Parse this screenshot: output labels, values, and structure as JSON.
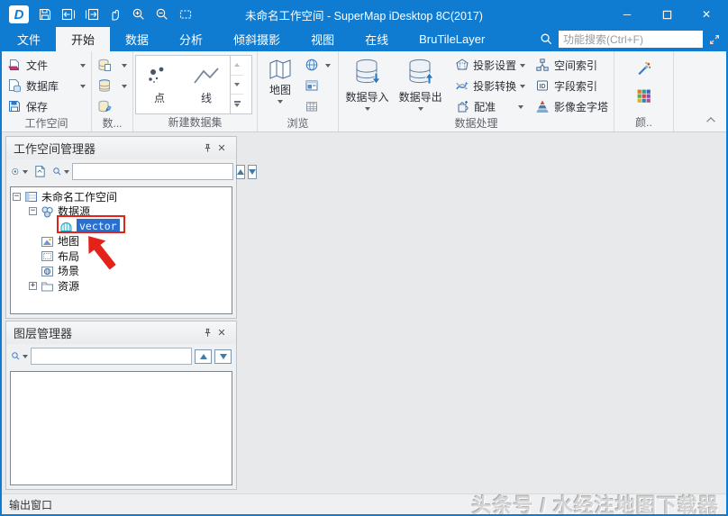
{
  "window": {
    "title": "未命名工作空间 - SuperMap iDesktop 8C(2017)"
  },
  "tabs": [
    {
      "label": "文件"
    },
    {
      "label": "开始",
      "active": true
    },
    {
      "label": "数据"
    },
    {
      "label": "分析"
    },
    {
      "label": "倾斜摄影"
    },
    {
      "label": "视图"
    },
    {
      "label": "在线"
    },
    {
      "label": "BruTileLayer"
    }
  ],
  "search": {
    "placeholder": "功能搜索(Ctrl+F)"
  },
  "ribbon": {
    "workspace": {
      "label": "工作空间",
      "file": "文件",
      "database": "数据库",
      "save": "保存"
    },
    "datasets_group": {
      "label": "数..."
    },
    "new_dataset": {
      "label": "新建数据集",
      "point": "点",
      "line": "线"
    },
    "browse": {
      "label": "浏览",
      "map": "地图"
    },
    "processing": {
      "label": "数据处理",
      "import": "数据导入",
      "export": "数据导出",
      "proj_settings": "投影设置",
      "proj_convert": "投影转换",
      "register": "配准",
      "spatial_index": "空间索引",
      "field_index": "字段索引",
      "pyramid": "影像金字塔"
    },
    "style_group": {
      "label": "颜.."
    }
  },
  "workspace_panel": {
    "title": "工作空间管理器",
    "tree": [
      {
        "label": "未命名工作空间"
      },
      {
        "label": "数据源"
      },
      {
        "label": "vector",
        "selected": true,
        "annotated": true
      },
      {
        "label": "地图"
      },
      {
        "label": "布局"
      },
      {
        "label": "场景"
      },
      {
        "label": "资源"
      }
    ]
  },
  "layer_panel": {
    "title": "图层管理器"
  },
  "statusbar": {
    "output_window": "输出窗口",
    "watermark": "头条号 / 水经注地图下载器"
  },
  "colors": {
    "titlebar": "#0f7cd2",
    "selection": "#2a6fd0",
    "annotation": "#e32219"
  },
  "icons": [
    "supermap-logo",
    "save",
    "nav-back",
    "nav-forward",
    "pan-hand",
    "zoom-in",
    "zoom-out",
    "full-extent",
    "search",
    "expand",
    "minimize",
    "maximize",
    "close",
    "pin",
    "datasource-udb",
    "folder",
    "globe",
    "map"
  ]
}
